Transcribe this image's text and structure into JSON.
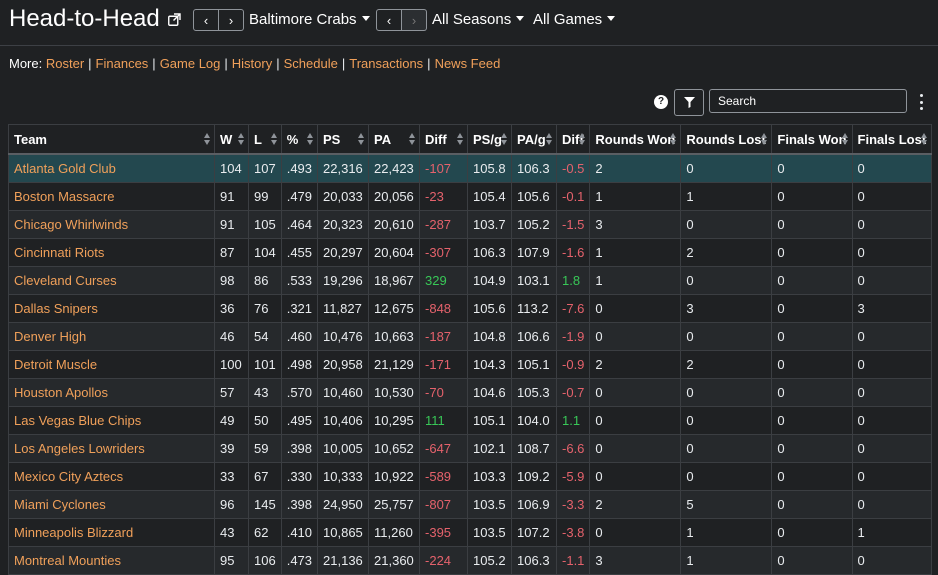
{
  "header": {
    "title": "Head-to-Head",
    "team_select": "Baltimore Crabs",
    "season_select": "All Seasons",
    "games_select": "All Games"
  },
  "more": {
    "label": "More:",
    "links": [
      "Roster",
      "Finances",
      "Game Log",
      "History",
      "Schedule",
      "Transactions",
      "News Feed"
    ]
  },
  "toolbar": {
    "search_placeholder": "Search"
  },
  "table": {
    "columns": [
      "Team",
      "W",
      "L",
      "%",
      "PS",
      "PA",
      "Diff",
      "PS/g",
      "PA/g",
      "Diff",
      "Rounds Won",
      "Rounds Lost",
      "Finals Won",
      "Finals Lost"
    ],
    "rows": [
      [
        "Atlanta Gold Club",
        "104",
        "107",
        ".493",
        "22,316",
        "22,423",
        "-107",
        "105.8",
        "106.3",
        "-0.5",
        "2",
        "0",
        "0",
        "0"
      ],
      [
        "Boston Massacre",
        "91",
        "99",
        ".479",
        "20,033",
        "20,056",
        "-23",
        "105.4",
        "105.6",
        "-0.1",
        "1",
        "1",
        "0",
        "0"
      ],
      [
        "Chicago Whirlwinds",
        "91",
        "105",
        ".464",
        "20,323",
        "20,610",
        "-287",
        "103.7",
        "105.2",
        "-1.5",
        "3",
        "0",
        "0",
        "0"
      ],
      [
        "Cincinnati Riots",
        "87",
        "104",
        ".455",
        "20,297",
        "20,604",
        "-307",
        "106.3",
        "107.9",
        "-1.6",
        "1",
        "2",
        "0",
        "0"
      ],
      [
        "Cleveland Curses",
        "98",
        "86",
        ".533",
        "19,296",
        "18,967",
        "329",
        "104.9",
        "103.1",
        "1.8",
        "1",
        "0",
        "0",
        "0"
      ],
      [
        "Dallas Snipers",
        "36",
        "76",
        ".321",
        "11,827",
        "12,675",
        "-848",
        "105.6",
        "113.2",
        "-7.6",
        "0",
        "3",
        "0",
        "3"
      ],
      [
        "Denver High",
        "46",
        "54",
        ".460",
        "10,476",
        "10,663",
        "-187",
        "104.8",
        "106.6",
        "-1.9",
        "0",
        "0",
        "0",
        "0"
      ],
      [
        "Detroit Muscle",
        "100",
        "101",
        ".498",
        "20,958",
        "21,129",
        "-171",
        "104.3",
        "105.1",
        "-0.9",
        "2",
        "2",
        "0",
        "0"
      ],
      [
        "Houston Apollos",
        "57",
        "43",
        ".570",
        "10,460",
        "10,530",
        "-70",
        "104.6",
        "105.3",
        "-0.7",
        "0",
        "0",
        "0",
        "0"
      ],
      [
        "Las Vegas Blue Chips",
        "49",
        "50",
        ".495",
        "10,406",
        "10,295",
        "111",
        "105.1",
        "104.0",
        "1.1",
        "0",
        "0",
        "0",
        "0"
      ],
      [
        "Los Angeles Lowriders",
        "39",
        "59",
        ".398",
        "10,005",
        "10,652",
        "-647",
        "102.1",
        "108.7",
        "-6.6",
        "0",
        "0",
        "0",
        "0"
      ],
      [
        "Mexico City Aztecs",
        "33",
        "67",
        ".330",
        "10,333",
        "10,922",
        "-589",
        "103.3",
        "109.2",
        "-5.9",
        "0",
        "0",
        "0",
        "0"
      ],
      [
        "Miami Cyclones",
        "96",
        "145",
        ".398",
        "24,950",
        "25,757",
        "-807",
        "103.5",
        "106.9",
        "-3.3",
        "2",
        "5",
        "0",
        "0"
      ],
      [
        "Minneapolis Blizzard",
        "43",
        "62",
        ".410",
        "10,865",
        "11,260",
        "-395",
        "103.5",
        "107.2",
        "-3.8",
        "0",
        "1",
        "0",
        "1"
      ],
      [
        "Montreal Mounties",
        "95",
        "106",
        ".473",
        "21,136",
        "21,360",
        "-224",
        "105.2",
        "106.3",
        "-1.1",
        "3",
        "1",
        "0",
        "0"
      ]
    ]
  },
  "colors": {
    "link": "#f0a05a",
    "negative": "#e5626c",
    "positive": "#38c757",
    "highlight_row": "#23484f"
  }
}
